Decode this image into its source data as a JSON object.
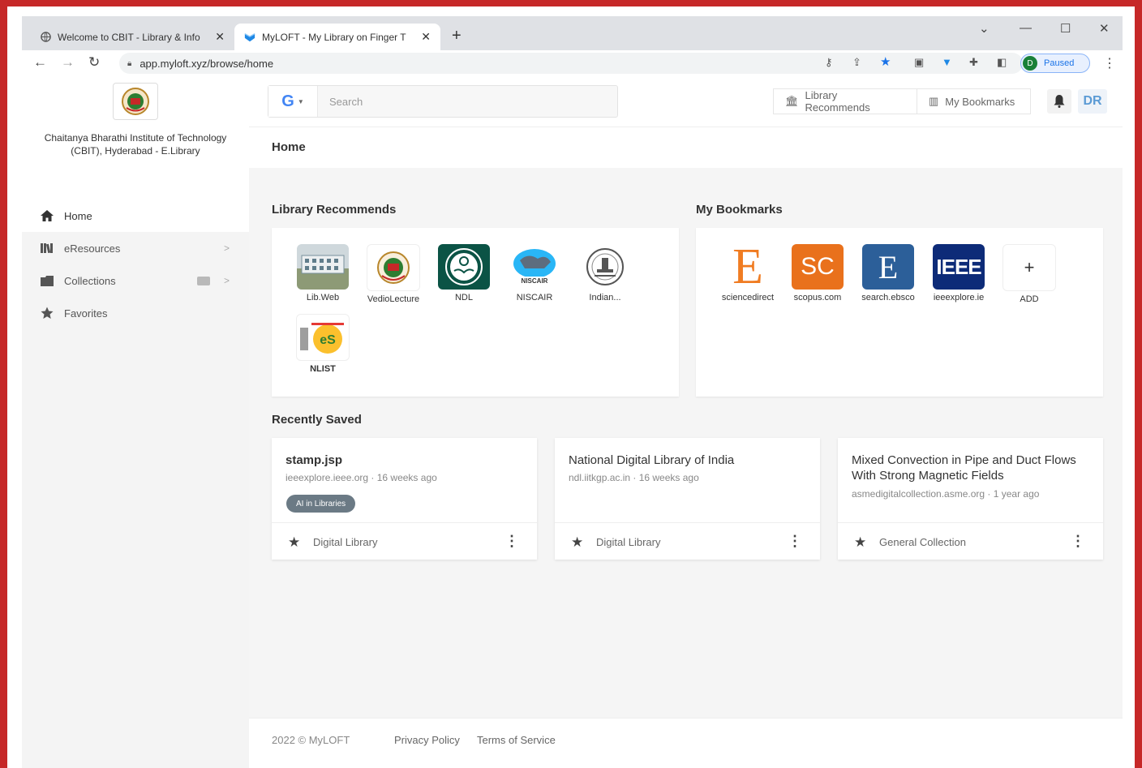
{
  "browser": {
    "tabs": [
      {
        "title": "Welcome to CBIT - Library & Info",
        "close": "✕"
      },
      {
        "title": "MyLOFT - My Library on Finger T",
        "close": "✕"
      }
    ],
    "new_tab": "+",
    "url": "app.myloft.xyz/browse/home",
    "profile_initial": "D",
    "profile_status": "Paused"
  },
  "sidebar": {
    "institution": "Chaitanya Bharathi Institute of Technology (CBIT), Hyderabad - E.Library",
    "items": [
      {
        "label": "Home",
        "icon": "home-icon"
      },
      {
        "label": "eResources",
        "icon": "books-icon"
      },
      {
        "label": "Collections",
        "icon": "folder-icon"
      },
      {
        "label": "Favorites",
        "icon": "star-icon"
      }
    ]
  },
  "topbar": {
    "search_placeholder": "Search",
    "library_recommends_btn": "Library Recommends",
    "my_bookmarks_btn": "My Bookmarks",
    "avatar_initials": "DR"
  },
  "page": {
    "title": "Home"
  },
  "library_recommends": {
    "title": "Library Recommends",
    "items": [
      {
        "label": "Lib.Web"
      },
      {
        "label": "VedioLecture"
      },
      {
        "label": "NDL"
      },
      {
        "label": "NISCAIR"
      },
      {
        "label": "Indian..."
      },
      {
        "label": "NLIST"
      }
    ]
  },
  "my_bookmarks": {
    "title": "My Bookmarks",
    "items": [
      {
        "label": "sciencedirect",
        "glyph": "E",
        "color": "#f07c22"
      },
      {
        "label": "scopus.com",
        "glyph": "SC",
        "color": "#e9711c"
      },
      {
        "label": "search.ebsco",
        "glyph": "E",
        "color": "#2c5f99"
      },
      {
        "label": "ieeexplore.ie",
        "glyph": "IEEE",
        "color": "#0d2b78"
      },
      {
        "label": "ADD",
        "glyph": "+",
        "color": "#ffffff"
      }
    ]
  },
  "recently_saved": {
    "title": "Recently Saved",
    "items": [
      {
        "title": "stamp.jsp",
        "source": "ieeexplore.ieee.org · 16 weeks ago",
        "tag": "AI in Libraries",
        "collection": "Digital Library"
      },
      {
        "title": "National Digital Library of India",
        "source": "ndl.iitkgp.ac.in · 16 weeks ago",
        "tag": "",
        "collection": "Digital Library"
      },
      {
        "title": "Mixed Convection in Pipe and Duct Flows With Strong Magnetic Fields",
        "source": "asmedigitalcollection.asme.org · 1 year ago",
        "tag": "",
        "collection": "General Collection"
      }
    ]
  },
  "footer": {
    "copyright": "2022 © MyLOFT",
    "privacy": "Privacy Policy",
    "terms": "Terms of Service"
  }
}
